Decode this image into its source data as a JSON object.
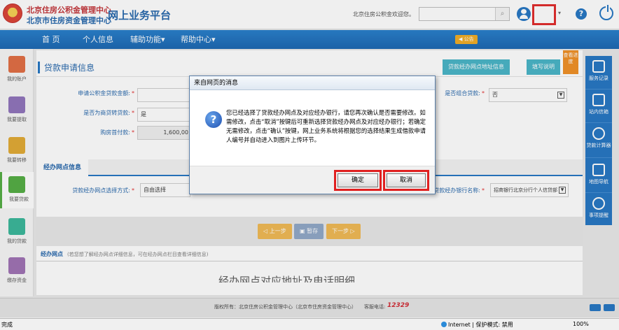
{
  "header": {
    "org_line1": "北京住房公积金管理中心",
    "org_line2": "北京市住房资金管理中心",
    "platform_title": "网上业务平台",
    "welcome": "北京住房公积金欢迎您。",
    "search_placeholder": "",
    "search_icon": "search-icon",
    "help_glyph": "?",
    "caret": "▾"
  },
  "nav": {
    "items": [
      "首 页",
      "个人信息",
      "辅助功能▾",
      "帮助中心▾"
    ],
    "notice": "◀ 公告"
  },
  "left_sidebar": {
    "items": [
      {
        "label": "我的账户",
        "color": "#e0663a"
      },
      {
        "label": "我要提取",
        "color": "#8a6db8"
      },
      {
        "label": "我要转移",
        "color": "#e0a62a"
      },
      {
        "label": "我要贷款",
        "color": "#4aa93a",
        "active": true
      },
      {
        "label": "我的贷款",
        "color": "#2fb394"
      },
      {
        "label": "缴存资金",
        "color": "#9a6ab0"
      }
    ]
  },
  "main": {
    "section_title": "贷款申请信息",
    "btn_outlet_address": "贷款经办网点地址信息",
    "btn_fill_guide": "填写说明",
    "tab_progress": "查看进度",
    "fields": {
      "apply_fund_amount_label": "申请公积金贷款金额:",
      "apply_fund_amount_value": "",
      "is_commercial_label": "是否为商贷转贷款:",
      "is_commercial_value": "是",
      "down_payment_label": "购房首付款:",
      "down_payment_value": "1,600,00",
      "is_combo_label": "是否组合贷款:",
      "is_combo_value": "否"
    },
    "outlet_tab": "经办网点信息",
    "outlet_fields": {
      "select_method_label": "贷款经办网点选择方式:",
      "select_method_value": "自由选择",
      "bank_name_label": "贷款经办银行名称:",
      "bank_name_value": "招商银行北京分行个人信贷部"
    },
    "steps": {
      "prev": "◁ 上一步",
      "save": "▣ 暂存",
      "next": "下一步 ▷"
    },
    "outlet_list_tab": "经办网点",
    "outlet_list_hint": "(若您想了解经办网点详细信息，可在经办网点栏目查看详细信息)",
    "partial_heading": "经办网点对应地址及电话明细"
  },
  "right_sidebar": {
    "items": [
      "服务记录",
      "站内信箱",
      "贷款计算器",
      "地图导航",
      "事项提醒"
    ]
  },
  "footer": {
    "copyright": "版权所有：北京住房公积金管理中心（北京市住房资金管理中心）",
    "hotline_label": "客服电话:",
    "hotline": "12329"
  },
  "statusbar": {
    "left": "完成",
    "zone": "Internet | 保护模式: 禁用",
    "zoom": "100%"
  },
  "dialog": {
    "title": "来自网页的消息",
    "icon": "question-icon",
    "message": "您已经选择了贷款经办网点及对应经办银行，请您再次确认是否需要修改。如需修改，点击“取消”按键后可重新选择贷款经办网点及对应经办银行；若确定无需修改，点击“确认”按键，网上业务系统将根据您的选择结果生成借款申请人编号并自动进入到图片上传环节。",
    "ok_label": "确定",
    "cancel_label": "取消"
  }
}
